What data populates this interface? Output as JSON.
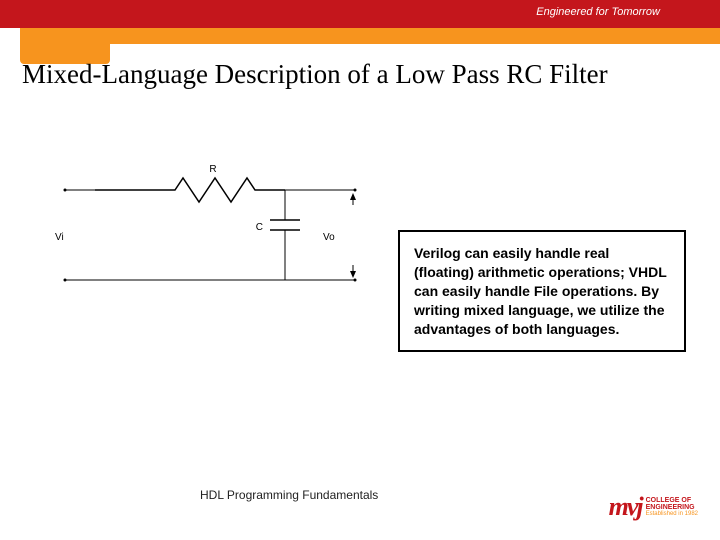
{
  "header": {
    "tagline": "Engineered for Tomorrow"
  },
  "title": "Mixed-Language Description of a Low Pass RC Filter",
  "circuit": {
    "r_label": "R",
    "c_label": "C",
    "vin_label": "Vi",
    "vout_label": "Vo"
  },
  "callout": {
    "text": "Verilog can easily handle real (floating) arithmetic operations; VHDL can easily handle File operations.  By writing mixed language, we utilize the advantages of both languages."
  },
  "footer": "HDL Programming Fundamentals",
  "logo": {
    "mark": "mvj",
    "line1": "COLLEGE OF",
    "line2": "ENGINEERING",
    "est": "Established in 1982"
  }
}
